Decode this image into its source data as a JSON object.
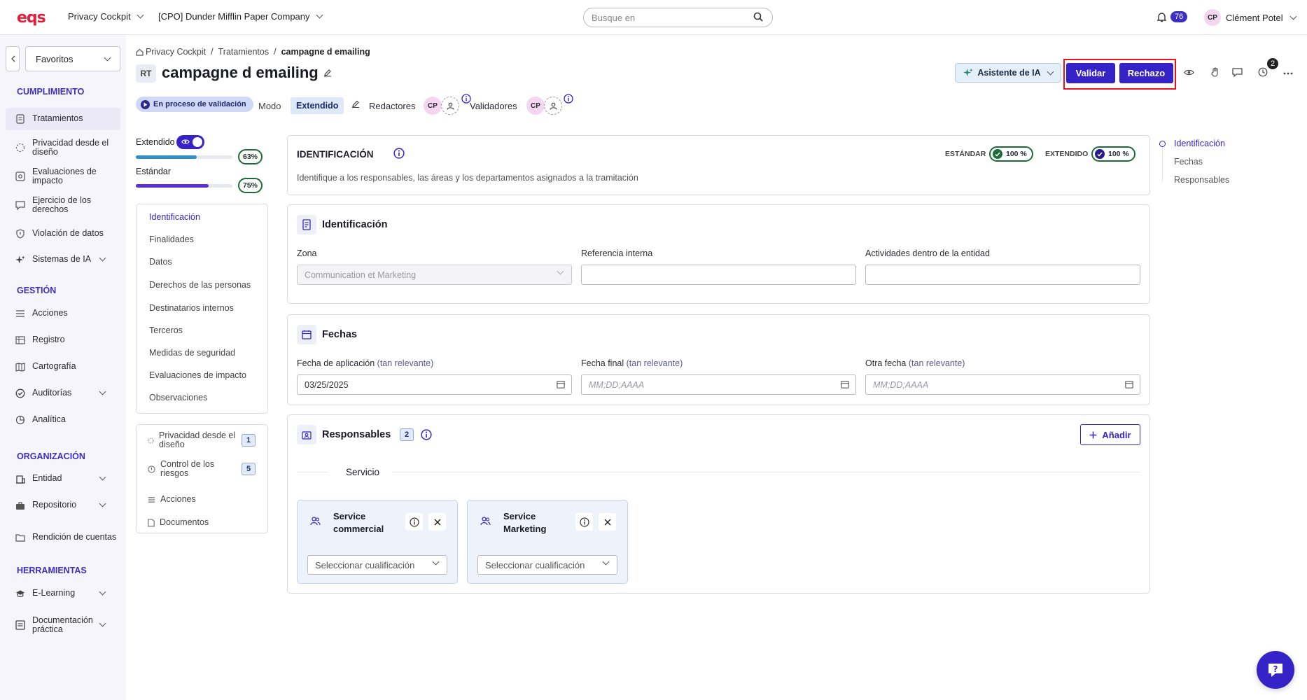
{
  "app": {
    "logo": "eqs",
    "module": "Privacy Cockpit",
    "company": "[CPO] Dunder Mifflin Paper Company",
    "search_placeholder": "Busque en",
    "notifications": "76",
    "user_initials": "CP",
    "user_name": "Clément Potel",
    "brand_color": "#e0213d",
    "accent_color": "#3523c8"
  },
  "sidebar": {
    "favorites": "Favoritos",
    "sections": {
      "cumplimiento": "CUMPLIMIENTO",
      "gestion": "GESTIÓN",
      "organizacion": "ORGANIZACIÓN",
      "herramientas": "HERRAMIENTAS"
    },
    "items": {
      "tratamientos": "Tratamientos",
      "privacidad": "Privacidad desde el diseño",
      "evaluaciones": "Evaluaciones de impacto",
      "ejercicio": "Ejercicio de los derechos",
      "violacion": "Violación de datos",
      "sistemas_ia": "Sistemas de IA",
      "acciones": "Acciones",
      "registro": "Registro",
      "cartografia": "Cartografía",
      "auditorias": "Auditorías",
      "analitica": "Analítica",
      "entidad": "Entidad",
      "repositorio": "Repositorio",
      "rendicion": "Rendición de cuentas",
      "elearning": "E-Learning",
      "documentacion": "Documentación práctica"
    }
  },
  "breadcrumb": {
    "root": "Privacy Cockpit",
    "level2": "Tratamientos",
    "current": "campagne d emailing"
  },
  "header": {
    "type_badge": "RT",
    "title": "campagne d emailing",
    "ai_assistant": "Asistente de IA",
    "validate": "Validar",
    "reject": "Rechazo",
    "history_count": "2",
    "status": "En proceso de validación",
    "mode_label": "Modo",
    "mode_value": "Extendido",
    "editors_label": "Redactores",
    "validators_label": "Validadores",
    "editor_initials": "CP",
    "validator_initials": "CP"
  },
  "progress": {
    "extended_label": "Extendido",
    "extended_pct": "63%",
    "extended_value": 0.63,
    "standard_label": "Estándar",
    "standard_pct": "75%",
    "standard_value": 0.75
  },
  "section_nav": {
    "items": {
      "identificacion": "Identificación",
      "finalidades": "Finalidades",
      "datos": "Datos",
      "derechos": "Derechos de las personas",
      "destinatarios": "Destinatarios internos",
      "terceros": "Terceros",
      "medidas": "Medidas de seguridad",
      "evaluaciones": "Evaluaciones de impacto",
      "observaciones": "Observaciones"
    },
    "links": {
      "privacidad_label": "Privacidad desde el diseño",
      "privacidad_count": "1",
      "control_label": "Control de los riesgos",
      "control_count": "5",
      "acciones_label": "Acciones",
      "documentos_label": "Documentos"
    }
  },
  "identification_header": {
    "title": "IDENTIFICACIÓN",
    "description": "Identifique a los responsables, las áreas y los departamentos asignados a la tramitación",
    "standard_label": "ESTÁNDAR",
    "standard_value": "100 %",
    "extended_label": "EXTENDIDO",
    "extended_value": "100 %"
  },
  "identification": {
    "title": "Identificación",
    "zone_label": "Zona",
    "zone_value": "Communication et Marketing",
    "ref_label": "Referencia interna",
    "ref_value": "",
    "activities_label": "Actividades dentro de la entidad",
    "activities_value": ""
  },
  "dates": {
    "title": "Fechas",
    "relevance": "(tan relevante)",
    "application_label": "Fecha de aplicación",
    "application_value": "03/25/2025",
    "end_label": "Fecha final",
    "end_placeholder": "MM;DD;AAAA",
    "other_label": "Otra fecha",
    "other_placeholder": "MM;DD;AAAA"
  },
  "responsables": {
    "title": "Responsables",
    "count": "2",
    "add": "Añadir",
    "group": "Servicio",
    "services": [
      {
        "name": "Service commercial",
        "select_placeholder": "Seleccionar cualificación"
      },
      {
        "name": "Service Marketing",
        "select_placeholder": "Seleccionar cualificación"
      }
    ]
  },
  "toc": {
    "identificacion": "Identificación",
    "fechas": "Fechas",
    "responsables": "Responsables"
  }
}
